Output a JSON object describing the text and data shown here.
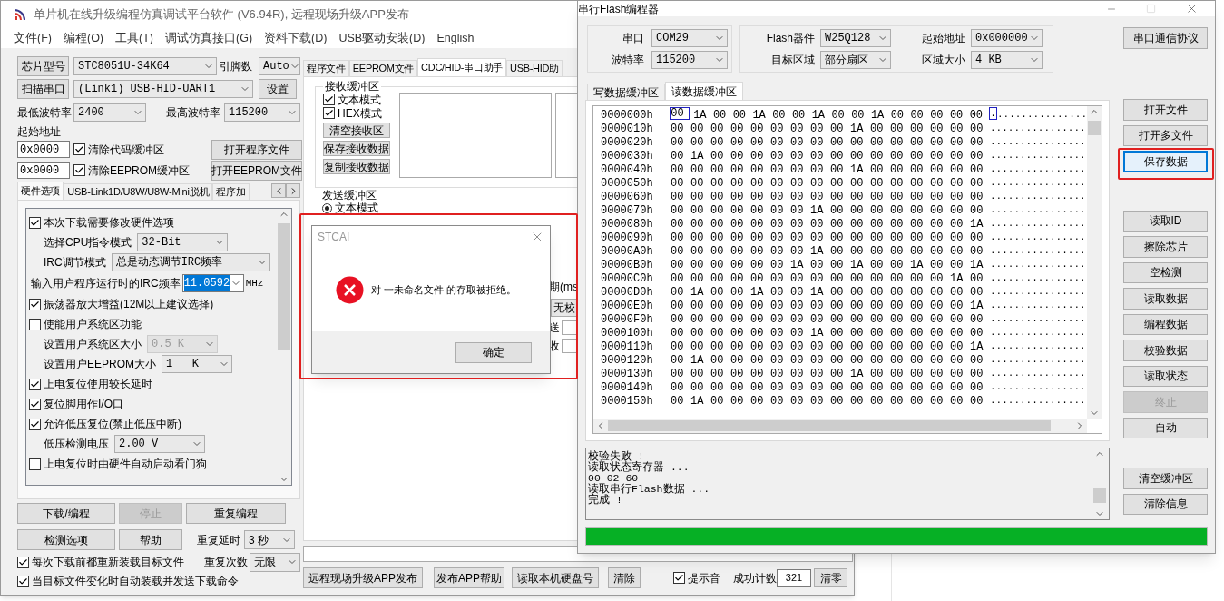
{
  "main_window": {
    "title": "单片机在线升级编程仿真调试平台软件 (V6.94R), 远程现场升级APP发布",
    "menu": [
      "文件(F)",
      "编程(O)",
      "工具(T)",
      "调试仿真接口(G)",
      "资料下载(D)",
      "USB驱动安装(D)",
      "English"
    ],
    "chip": {
      "button": "芯片型号",
      "value": "STC8051U-34K64",
      "pins_label": "引脚数",
      "pins_value": "Auto"
    },
    "port": {
      "button": "扫描串口",
      "value": "(Link1) USB-HID-UART1",
      "settings_button": "设置"
    },
    "baud": {
      "min_label": "最低波特率",
      "min_value": "2400",
      "max_label": "最高波特率",
      "max_value": "115200"
    },
    "start_address": {
      "label": "起始地址",
      "rows": [
        {
          "value": "0x0000",
          "checkbox": "清除代码缓冲区",
          "checked": true,
          "button": "打开程序文件"
        },
        {
          "value": "0x0000",
          "checkbox": "清除EEPROM缓冲区",
          "checked": true,
          "button": "打开EEPROM文件"
        }
      ]
    },
    "option_tabs": [
      {
        "label": "硬件选项",
        "selected": true
      },
      {
        "label": "USB-Link1D/U8W/U8W-Mini脱机",
        "selected": false
      },
      {
        "label": "程序加",
        "selected": false
      }
    ],
    "hardware_options": [
      {
        "kind": "checkbox",
        "label": "本次下载需要修改硬件选项",
        "checked": true
      },
      {
        "kind": "select",
        "label": "选择CPU指令模式",
        "value": "32-Bit",
        "disabled": false
      },
      {
        "kind": "select",
        "label": "IRC调节模式",
        "value": "总是动态调节IRC频率",
        "disabled": false
      },
      {
        "kind": "input",
        "label": "输入用户程序运行时的IRC频率",
        "value": "11.0592",
        "unit": "MHz"
      },
      {
        "kind": "checkbox",
        "label": "振荡器放大增益(12M以上建议选择)",
        "checked": true
      },
      {
        "kind": "checkbox",
        "label": "使能用户系统区功能",
        "checked": false
      },
      {
        "kind": "select",
        "label": "设置用户系统区大小",
        "value": "0.5 K",
        "disabled": true
      },
      {
        "kind": "select",
        "label": "设置用户EEPROM大小",
        "value": "1   K",
        "disabled": false
      },
      {
        "kind": "checkbox",
        "label": "上电复位使用较长延时",
        "checked": true
      },
      {
        "kind": "checkbox",
        "label": "复位脚用作I/O口",
        "checked": true
      },
      {
        "kind": "checkbox",
        "label": "允许低压复位(禁止低压中断)",
        "checked": true
      },
      {
        "kind": "select",
        "label": "低压检测电压",
        "value": "2.00 V",
        "disabled": false
      },
      {
        "kind": "checkbox",
        "label": "上电复位时由硬件自动启动看门狗",
        "checked": false
      }
    ],
    "action_buttons": [
      {
        "label": "下载/编程",
        "disabled": false
      },
      {
        "label": "停止",
        "disabled": true
      },
      {
        "label": "重复编程",
        "disabled": false
      },
      {
        "label": "检测选项",
        "disabled": false
      },
      {
        "label": "帮助",
        "disabled": false
      }
    ],
    "repeat": {
      "delay_label": "重复延时",
      "delay_value": "3 秒",
      "count_label": "重复次数",
      "count_value": "无限"
    },
    "reload_options": [
      {
        "label": "每次下载前都重新装载目标文件",
        "checked": true
      },
      {
        "label": "当目标文件变化时自动装载并发送下载命令",
        "checked": true
      }
    ],
    "assistant_tabs": [
      {
        "label": "程序文件",
        "selected": false
      },
      {
        "label": "EEPROM文件",
        "selected": false
      },
      {
        "label": "CDC/HID-串口助手",
        "selected": true
      },
      {
        "label": "USB-HID助",
        "selected": false
      }
    ],
    "receive_buffer": {
      "title": "接收缓冲区",
      "modes": [
        {
          "label": "文本模式",
          "checked": true
        },
        {
          "label": "HEX模式",
          "checked": true
        }
      ],
      "buttons": [
        "清空接收区",
        "保存接收数据",
        "复制接收数据"
      ]
    },
    "send_buffer": {
      "title": "发送缓冲区",
      "modes": [
        {
          "label": "文本模式",
          "selected": true
        }
      ]
    },
    "partial_labels": [
      {
        "kind": "label",
        "text": "期(ms"
      },
      {
        "kind": "select",
        "text": "无校"
      },
      {
        "kind": "field",
        "text": "送"
      },
      {
        "kind": "field",
        "text": "收"
      }
    ],
    "bottom_bar": {
      "buttons": [
        "远程现场升级APP发布",
        "发布APP帮助",
        "读取本机硬盘号",
        "清除"
      ],
      "beep": {
        "label": "提示音",
        "checked": true
      },
      "count_label": "成功计数",
      "count_value": "321",
      "reset_button": "清零"
    }
  },
  "dialog": {
    "title": "STCAI",
    "message": "对 一未命名文件 的存取被拒绝。",
    "button": "确定"
  },
  "flash_window": {
    "title": "串行Flash编程器",
    "port_group": [
      {
        "label": "串口",
        "value": "COM29"
      },
      {
        "label": "波特率",
        "value": "115200"
      }
    ],
    "flash_group": [
      {
        "label": "Flash器件",
        "value": "W25Q128"
      },
      {
        "label": "起始地址",
        "value": "0x000000"
      },
      {
        "label": "目标区域",
        "value": "部分扇区"
      },
      {
        "label": "区域大小",
        "value": "4 KB"
      }
    ],
    "buffer_tabs": [
      {
        "label": "写数据缓冲区",
        "selected": false
      },
      {
        "label": "读数据缓冲区",
        "selected": true
      }
    ],
    "hex_rows": [
      {
        "address": "0000000h",
        "bytes": "00 1A 00 00 1A 00 00 1A 00 00 1A 00 00 00 00 00",
        "ascii": "................",
        "selected": true
      },
      {
        "address": "0000010h",
        "bytes": "00 00 00 00 00 00 00 00 00 1A 00 00 00 00 00 00",
        "ascii": "................",
        "selected": false
      },
      {
        "address": "0000020h",
        "bytes": "00 00 00 00 00 00 00 00 00 00 00 00 00 00 00 00",
        "ascii": "................",
        "selected": false
      },
      {
        "address": "0000030h",
        "bytes": "00 1A 00 00 00 00 00 00 00 00 00 00 00 00 00 00",
        "ascii": "................",
        "selected": false
      },
      {
        "address": "0000040h",
        "bytes": "00 00 00 00 00 00 00 00 00 1A 00 00 00 00 00 00",
        "ascii": "................",
        "selected": false
      },
      {
        "address": "0000050h",
        "bytes": "00 00 00 00 00 00 00 00 00 00 00 00 00 00 00 00",
        "ascii": "................",
        "selected": false
      },
      {
        "address": "0000060h",
        "bytes": "00 00 00 00 00 00 00 00 00 00 00 00 00 00 00 00",
        "ascii": "................",
        "selected": false
      },
      {
        "address": "0000070h",
        "bytes": "00 00 00 00 00 00 00 1A 00 00 00 00 00 00 00 00",
        "ascii": "................",
        "selected": false
      },
      {
        "address": "0000080h",
        "bytes": "00 00 00 00 00 00 00 00 00 00 00 00 00 00 00 1A",
        "ascii": "................",
        "selected": false
      },
      {
        "address": "0000090h",
        "bytes": "00 00 00 00 00 00 00 00 00 00 00 00 00 00 00 00",
        "ascii": "................",
        "selected": false
      },
      {
        "address": "00000A0h",
        "bytes": "00 00 00 00 00 00 00 1A 00 00 00 00 00 00 00 00",
        "ascii": "................",
        "selected": false
      },
      {
        "address": "00000B0h",
        "bytes": "00 00 00 00 00 00 1A 00 00 1A 00 00 1A 00 00 1A",
        "ascii": "................",
        "selected": false
      },
      {
        "address": "00000C0h",
        "bytes": "00 00 00 00 00 00 00 00 00 00 00 00 00 00 1A 00",
        "ascii": "................",
        "selected": false
      },
      {
        "address": "00000D0h",
        "bytes": "00 1A 00 00 1A 00 00 1A 00 00 00 00 00 00 00 00",
        "ascii": "................",
        "selected": false
      },
      {
        "address": "00000E0h",
        "bytes": "00 00 00 00 00 00 00 00 00 00 00 00 00 00 00 1A",
        "ascii": "................",
        "selected": false
      },
      {
        "address": "00000F0h",
        "bytes": "00 00 00 00 00 00 00 00 00 00 00 00 00 00 00 00",
        "ascii": "................",
        "selected": false
      },
      {
        "address": "0000100h",
        "bytes": "00 00 00 00 00 00 00 1A 00 00 00 00 00 00 00 00",
        "ascii": "................",
        "selected": false
      },
      {
        "address": "0000110h",
        "bytes": "00 00 00 00 00 00 00 00 00 00 00 00 00 00 00 1A",
        "ascii": "................",
        "selected": false
      },
      {
        "address": "0000120h",
        "bytes": "00 1A 00 00 00 00 00 00 00 00 00 00 00 00 00 00",
        "ascii": "................",
        "selected": false
      },
      {
        "address": "0000130h",
        "bytes": "00 00 00 00 00 00 00 00 00 1A 00 00 00 00 00 00",
        "ascii": "................",
        "selected": false
      },
      {
        "address": "0000140h",
        "bytes": "00 00 00 00 00 00 00 00 00 00 00 00 00 00 00 00",
        "ascii": "................",
        "selected": false
      },
      {
        "address": "0000150h",
        "bytes": "00 1A 00 00 00 00 00 00 00 00 00 00 00 00 00 00",
        "ascii": "................",
        "selected": false
      }
    ],
    "log": [
      "校验失败 !",
      "读取状态寄存器 ...",
      "00 02 60",
      "读取串行Flash数据 ...",
      "完成 !"
    ],
    "progress": {
      "level": 1
    },
    "button_groups": [
      [
        {
          "label": "串口通信协议",
          "focused": false,
          "disabled": false
        }
      ],
      [
        {
          "label": "打开文件",
          "focused": false,
          "disabled": false
        },
        {
          "label": "打开多文件",
          "focused": false,
          "disabled": false
        },
        {
          "label": "保存数据",
          "focused": true,
          "disabled": false
        }
      ],
      [
        {
          "label": "读取ID",
          "focused": false,
          "disabled": false
        },
        {
          "label": "擦除芯片",
          "focused": false,
          "disabled": false
        },
        {
          "label": "空检测",
          "focused": false,
          "disabled": false
        },
        {
          "label": "读取数据",
          "focused": false,
          "disabled": false
        },
        {
          "label": "编程数据",
          "focused": false,
          "disabled": false
        },
        {
          "label": "校验数据",
          "focused": false,
          "disabled": false
        },
        {
          "label": "读取状态",
          "focused": false,
          "disabled": false
        },
        {
          "label": "终止",
          "focused": false,
          "disabled": true
        },
        {
          "label": "自动",
          "focused": false,
          "disabled": false
        }
      ],
      [
        {
          "label": "清空缓冲区",
          "focused": false,
          "disabled": false
        },
        {
          "label": "清除信息",
          "focused": false,
          "disabled": false
        }
      ]
    ]
  }
}
